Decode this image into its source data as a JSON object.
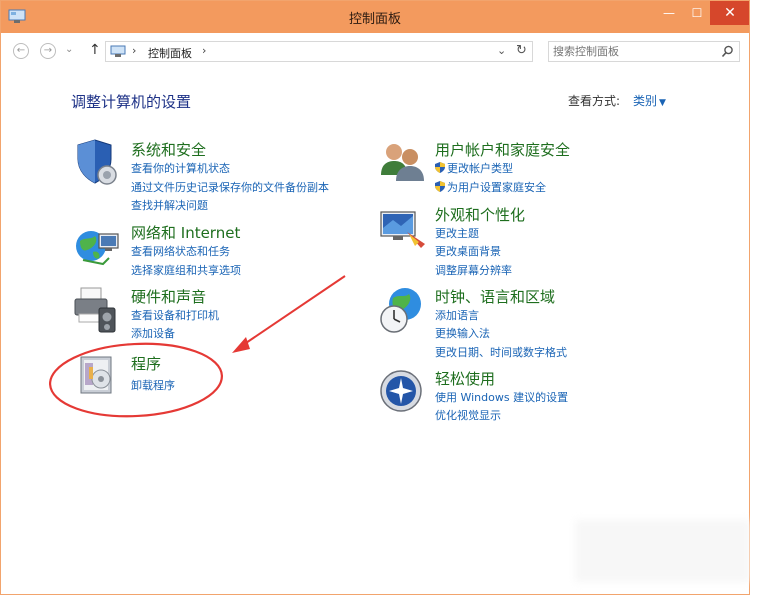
{
  "window": {
    "title": "控制面板",
    "accent": "#f39a5e",
    "close_color": "#d6472b",
    "min_glyph": "—",
    "max_glyph": "☐",
    "close_glyph": "✕"
  },
  "toolbar": {
    "back_glyph": "←",
    "forward_glyph": "→",
    "recent_glyph": "⌄",
    "up_glyph": "↑",
    "breadcrumb_sep": "›",
    "breadcrumb": "控制面板",
    "dropdown_glyph": "⌄",
    "refresh_glyph": "↻",
    "search_placeholder": "搜索控制面板"
  },
  "main": {
    "heading": "调整计算机的设置",
    "view_by_label": "查看方式:",
    "view_by_value": "类别",
    "view_by_caret": "▼"
  },
  "categories": [
    {
      "title": "系统和安全",
      "icon": "shield-icon",
      "links": [
        "查看你的计算机状态",
        "通过文件历史记录保存你的文件备份副本",
        "查找并解决问题"
      ]
    },
    {
      "title": "网络和 Internet",
      "icon": "network-icon",
      "links": [
        "查看网络状态和任务",
        "选择家庭组和共享选项"
      ]
    },
    {
      "title": "硬件和声音",
      "icon": "printer-icon",
      "links": [
        "查看设备和打印机",
        "添加设备"
      ]
    },
    {
      "title": "程序",
      "icon": "programs-icon",
      "links": [
        "卸载程序"
      ]
    },
    {
      "title": "用户帐户和家庭安全",
      "icon": "users-icon",
      "links": [
        "更改帐户类型",
        "为用户设置家庭安全"
      ]
    },
    {
      "title": "外观和个性化",
      "icon": "appearance-icon",
      "links": [
        "更改主题",
        "更改桌面背景",
        "调整屏幕分辨率"
      ]
    },
    {
      "title": "时钟、语言和区域",
      "icon": "clock-globe-icon",
      "links": [
        "添加语言",
        "更换输入法",
        "更改日期、时间或数字格式"
      ]
    },
    {
      "title": "轻松使用",
      "icon": "ease-of-access-icon",
      "links": [
        "使用 Windows 建议的设置",
        "优化视觉显示"
      ]
    }
  ],
  "annotation": {
    "color": "#e53935"
  }
}
